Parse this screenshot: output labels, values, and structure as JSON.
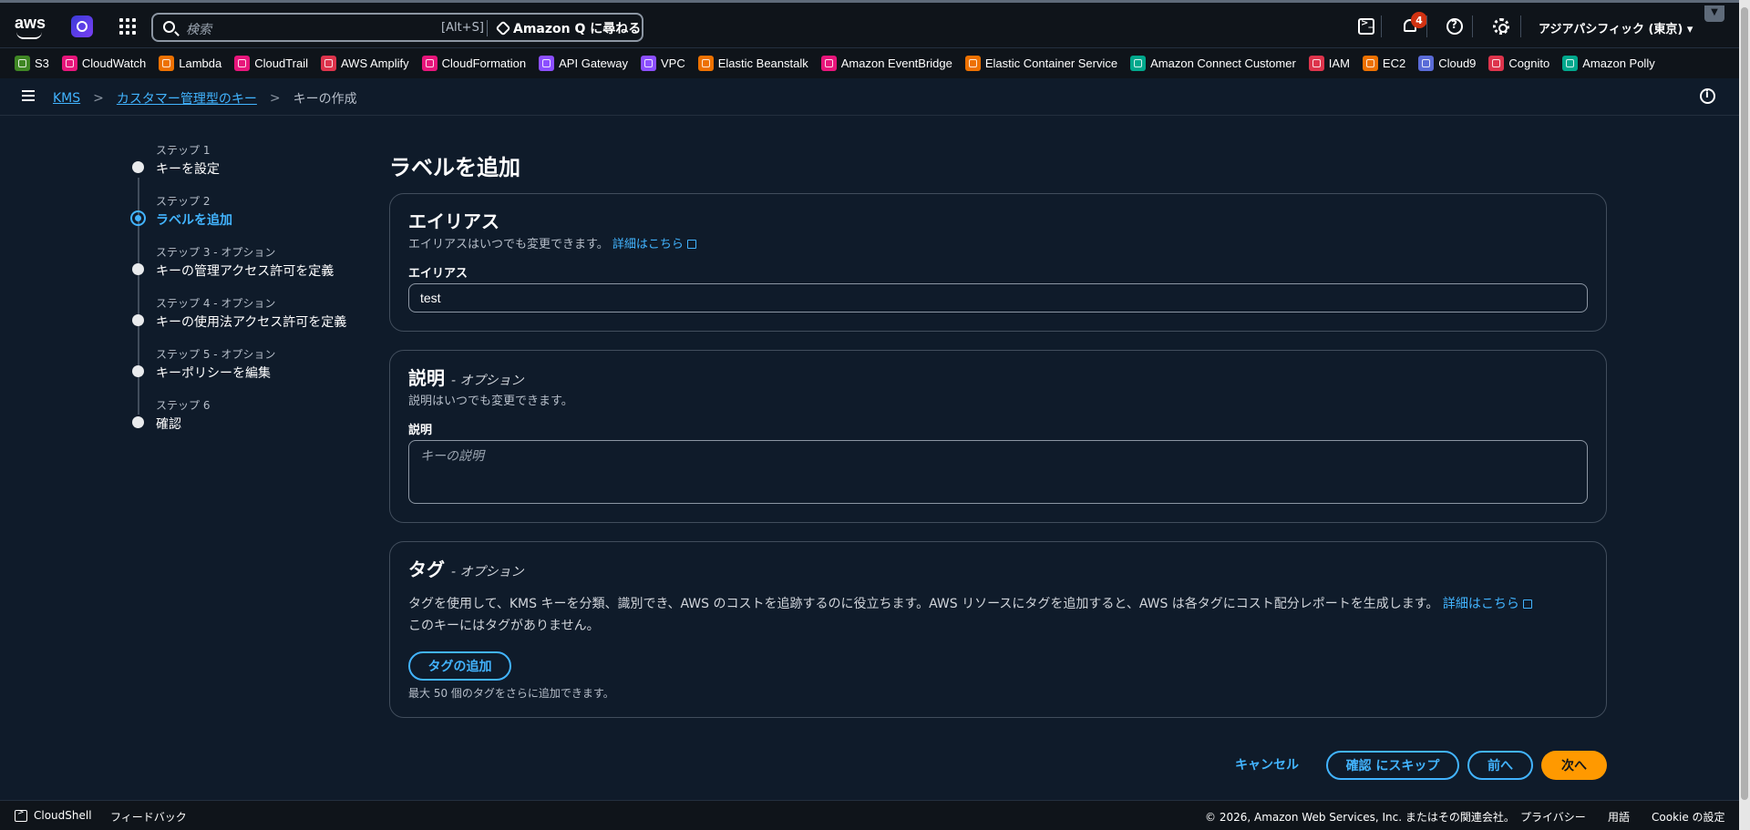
{
  "nav": {
    "search_placeholder": "検索",
    "search_shortcut": "[Alt+S]",
    "ask_q": "Amazon Q に尋ねる",
    "notification_count": "4",
    "region": "アジアパシフィック (東京)",
    "logo_text": "aws"
  },
  "favorites": [
    {
      "label": "S3",
      "color": "#3f8624"
    },
    {
      "label": "CloudWatch",
      "color": "#e7157b"
    },
    {
      "label": "Lambda",
      "color": "#ed7100"
    },
    {
      "label": "CloudTrail",
      "color": "#e7157b"
    },
    {
      "label": "AWS Amplify",
      "color": "#dd344c"
    },
    {
      "label": "CloudFormation",
      "color": "#e7157b"
    },
    {
      "label": "API Gateway",
      "color": "#8c4fff"
    },
    {
      "label": "VPC",
      "color": "#8c4fff"
    },
    {
      "label": "Elastic Beanstalk",
      "color": "#ed7100"
    },
    {
      "label": "Amazon EventBridge",
      "color": "#e7157b"
    },
    {
      "label": "Elastic Container Service",
      "color": "#ed7100"
    },
    {
      "label": "Amazon Connect Customer",
      "color": "#01a88d"
    },
    {
      "label": "IAM",
      "color": "#dd344c"
    },
    {
      "label": "EC2",
      "color": "#ed7100"
    },
    {
      "label": "Cloud9",
      "color": "#5a6bd7"
    },
    {
      "label": "Cognito",
      "color": "#dd344c"
    },
    {
      "label": "Amazon Polly",
      "color": "#01a88d"
    }
  ],
  "breadcrumb": {
    "kms": "KMS",
    "cmk": "カスタマー管理型のキー",
    "current": "キーの作成"
  },
  "steps": [
    {
      "label": "ステップ 1",
      "name": "キーを設定"
    },
    {
      "label": "ステップ 2",
      "name": "ラベルを追加"
    },
    {
      "label": "ステップ 3 - オプション",
      "name": "キーの管理アクセス許可を定義"
    },
    {
      "label": "ステップ 4 - オプション",
      "name": "キーの使用法アクセス許可を定義"
    },
    {
      "label": "ステップ 5 - オプション",
      "name": "キーポリシーを編集"
    },
    {
      "label": "ステップ 6",
      "name": "確認"
    }
  ],
  "page_title": "ラベルを追加",
  "alias": {
    "heading": "エイリアス",
    "description": "エイリアスはいつでも変更できます。",
    "learn_more": "詳細はこちら",
    "field_label": "エイリアス",
    "value": "test"
  },
  "description_panel": {
    "heading": "説明",
    "optional": "- オプション",
    "description": "説明はいつでも変更できます。",
    "field_label": "説明",
    "placeholder": "キーの説明"
  },
  "tags": {
    "heading": "タグ",
    "optional": "- オプション",
    "description": "タグを使用して、KMS キーを分類、識別でき、AWS のコストを追跡するのに役立ちます。AWS リソースにタグを追加すると、AWS は各タグにコスト配分レポートを生成します。",
    "learn_more": "詳細はこちら",
    "empty": "このキーにはタグがありません。",
    "add_button": "タグの追加",
    "limit_note": "最大 50 個のタグをさらに追加できます。"
  },
  "actions": {
    "cancel": "キャンセル",
    "skip": "確認 にスキップ",
    "previous": "前へ",
    "next": "次へ"
  },
  "footer": {
    "cloudshell": "CloudShell",
    "feedback": "フィードバック",
    "copyright": "© 2026, Amazon Web Services, Inc. またはその関連会社。",
    "privacy": "プライバシー",
    "terms": "用語",
    "cookie": "Cookie の設定"
  }
}
